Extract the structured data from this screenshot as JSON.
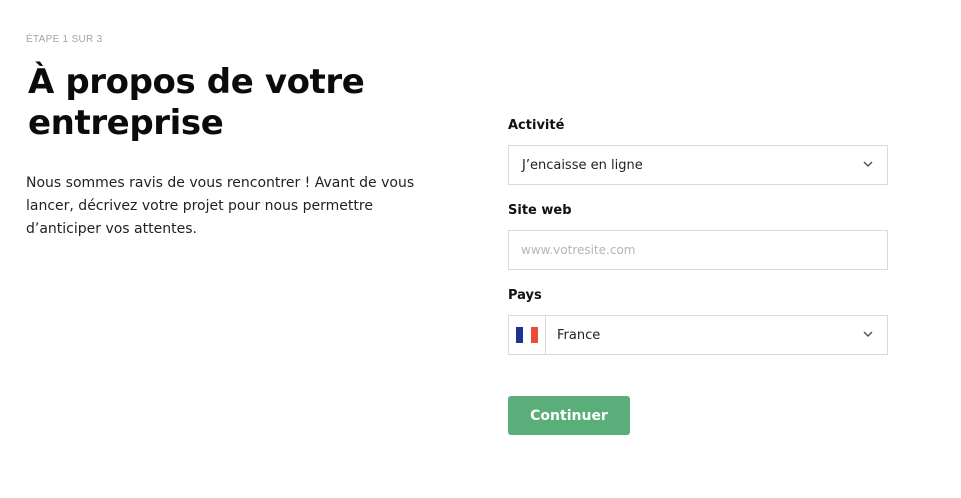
{
  "header": {
    "step": "ÉTAPE 1 SUR 3",
    "title": "À propos de votre entreprise",
    "intro": "Nous sommes ravis de vous rencontrer ! Avant de vous lancer, décrivez votre projet pour nous permettre d’anticiper vos attentes."
  },
  "form": {
    "activity": {
      "label": "Activité",
      "value": "J’encaisse en ligne",
      "icon": "chevron-down-icon"
    },
    "website": {
      "label": "Site web",
      "placeholder": "www.votresite.com",
      "value": ""
    },
    "country": {
      "label": "Pays",
      "value": "France",
      "flag_icon": "france-flag-icon",
      "flag_colors": [
        "#20328f",
        "#ffffff",
        "#ed4b3a"
      ],
      "icon": "chevron-down-icon"
    },
    "continue_label": "Continuer"
  },
  "colors": {
    "accent": "#5aae7a",
    "border": "#d9d9d9",
    "muted_text": "#a3a3a3"
  }
}
